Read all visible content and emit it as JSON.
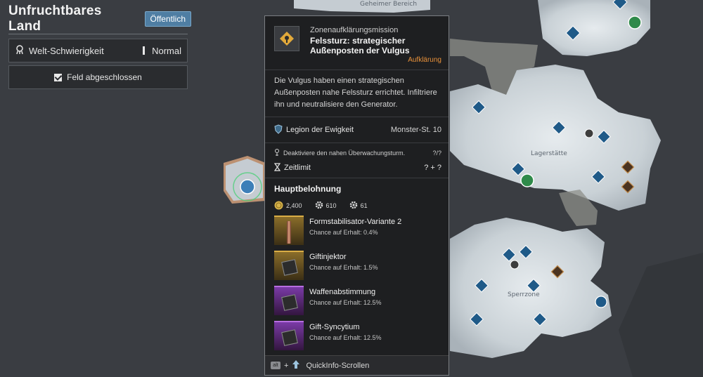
{
  "zone": {
    "title": "Unfruchtbares Land",
    "visibility_badge": "Öffentlich"
  },
  "difficulty": {
    "label": "Welt-Schwierigkeit",
    "value": "Normal",
    "icon": "difficulty-icon"
  },
  "field_status": {
    "label": "Feld abgeschlossen",
    "icon": "checkbox-icon"
  },
  "map": {
    "labels": {
      "secret_area": "Geheimer Bereich",
      "camp": "Lagerstätte",
      "restricted": "Sperrzone"
    }
  },
  "mission": {
    "type": "Zonenaufklärungsmission",
    "name_line1": "Felssturz: strategischer",
    "name_line2": "Außenposten der Vulgus",
    "tag": "Aufklärung",
    "tag_color": "#e8913a",
    "description": "Die Vulgus haben einen strategischen Außenposten nahe Felssturz errichtet. Infiltriere ihn und neutralisiere den Generator.",
    "faction": "Legion der Ewigkeit",
    "monster_level": "Monster-St. 10",
    "objective": "Deaktiviere den nahen Überwachungsturm.",
    "objective_value": "?/?",
    "time_limit_label": "Zeitlimit",
    "time_limit_value": "? + ?"
  },
  "rewards": {
    "title": "Hauptbelohnung",
    "currencies": [
      {
        "icon": "gold-coin-icon",
        "value": "2,400"
      },
      {
        "icon": "gear-icon",
        "value": "610"
      },
      {
        "icon": "gear-icon",
        "value": "61"
      }
    ],
    "items": [
      {
        "name": "Formstabilisator-Variante 2",
        "chance": "Chance auf Erhalt: 0.4%",
        "rarity": "gold"
      },
      {
        "name": "Giftinjektor",
        "chance": "Chance auf Erhalt: 1.5%",
        "rarity": "gold"
      },
      {
        "name": "Waffenabstimmung",
        "chance": "Chance auf Erhalt: 12.5%",
        "rarity": "purple"
      },
      {
        "name": "Gift-Syncytium",
        "chance": "Chance auf Erhalt: 12.5%",
        "rarity": "purple"
      }
    ]
  },
  "footer": {
    "key_label": "alt",
    "action": "QuickInfo-Scrollen"
  }
}
